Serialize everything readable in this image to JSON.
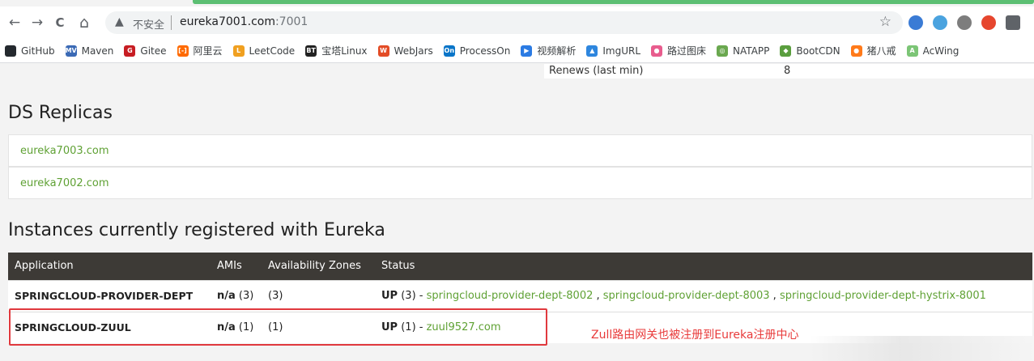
{
  "browser": {
    "nav": {
      "back": "←",
      "forward": "→",
      "reload": "C",
      "home": "⌂"
    },
    "address": {
      "warning_icon": "▲",
      "security_label": "不安全",
      "url_host": "eureka7001.com",
      "url_port": ":7001",
      "star": "☆"
    },
    "extensions": [
      {
        "name": "ext-pinwheel-icon",
        "color": "#3a7bd5"
      },
      {
        "name": "ext-globe-icon",
        "color": "#4aa3df"
      },
      {
        "name": "ext-chart-icon",
        "color": "#7d7d7d"
      },
      {
        "name": "ext-weibo-icon",
        "color": "#e6462e"
      },
      {
        "name": "ext-puzzle-icon",
        "color": "#5f6368"
      }
    ],
    "bookmarks": [
      {
        "label": "GitHub",
        "color": "#24292e",
        "glyph": ""
      },
      {
        "label": "Maven",
        "color": "#3b6ab5",
        "glyph": "MVN"
      },
      {
        "label": "Gitee",
        "color": "#c71d23",
        "glyph": "G"
      },
      {
        "label": "阿里云",
        "color": "#ff6a00",
        "glyph": "[-]"
      },
      {
        "label": "LeetCode",
        "color": "#f0a020",
        "glyph": "L"
      },
      {
        "label": "宝塔Linux",
        "color": "#222222",
        "glyph": "BT"
      },
      {
        "label": "WebJars",
        "color": "#e34c26",
        "glyph": "W"
      },
      {
        "label": "ProcessOn",
        "color": "#0a75c8",
        "glyph": "On"
      },
      {
        "label": "视频解析",
        "color": "#2b7be3",
        "glyph": "▶"
      },
      {
        "label": "ImgURL",
        "color": "#2e86de",
        "glyph": "▲"
      },
      {
        "label": "路过图床",
        "color": "#e85d8e",
        "glyph": "●"
      },
      {
        "label": "NATAPP",
        "color": "#6aa84f",
        "glyph": "◎"
      },
      {
        "label": "BootCDN",
        "color": "#5a9e3e",
        "glyph": "◆"
      },
      {
        "label": "猪八戒",
        "color": "#ff7a1a",
        "glyph": "●"
      },
      {
        "label": "AcWing",
        "color": "#7cc576",
        "glyph": "A"
      }
    ]
  },
  "page": {
    "renews": {
      "label": "Renews (last min)",
      "value": "8"
    },
    "replicas_title": "DS Replicas",
    "replicas": [
      "eureka7003.com",
      "eureka7002.com"
    ],
    "instances_title": "Instances currently registered with Eureka",
    "table": {
      "headers": [
        "Application",
        "AMIs",
        "Availability Zones",
        "Status"
      ],
      "rows": [
        {
          "application": "SPRINGCLOUD-PROVIDER-DEPT",
          "amis_na": "n/a",
          "amis_count": " (3)",
          "zones": "(3)",
          "status_up": "UP",
          "status_count": " (3) - ",
          "links": [
            "springcloud-provider-dept-8002",
            "springcloud-provider-dept-8003",
            "springcloud-provider-dept-hystrix-8001"
          ],
          "separator": " , "
        },
        {
          "application": "SPRINGCLOUD-ZUUL",
          "amis_na": "n/a",
          "amis_count": " (1)",
          "zones": "(1)",
          "status_up": "UP",
          "status_count": " (1) - ",
          "links": [
            "zuul9527.com"
          ],
          "separator": ""
        }
      ]
    },
    "annotation": "Zull路由网关也被注册到Eureka注册中心"
  },
  "colors": {
    "link": "#5fa134",
    "header_bg": "#3d3a36",
    "annotation": "#e83a3a",
    "progress": "#5cbf73"
  }
}
